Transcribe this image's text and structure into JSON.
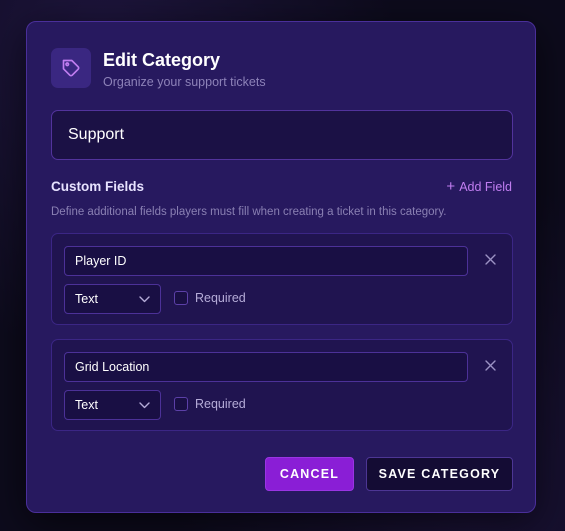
{
  "modal": {
    "title": "Edit Category",
    "subtitle": "Organize your support tickets",
    "icon": "tag-icon",
    "category_name": "Support"
  },
  "custom_fields": {
    "title": "Custom Fields",
    "add_label": "Add Field",
    "description": "Define additional fields players must fill when creating a ticket in this category.",
    "fields": [
      {
        "name": "Player ID",
        "type": "Text",
        "required": false,
        "required_label": "Required"
      },
      {
        "name": "Grid Location",
        "type": "Text",
        "required": false,
        "required_label": "Required"
      }
    ]
  },
  "actions": {
    "cancel_label": "CANCEL",
    "save_label": "SAVE CATEGORY"
  },
  "colors": {
    "accent": "#8a1ed6",
    "link": "#c07df0",
    "modal_bg": "#27195f"
  }
}
